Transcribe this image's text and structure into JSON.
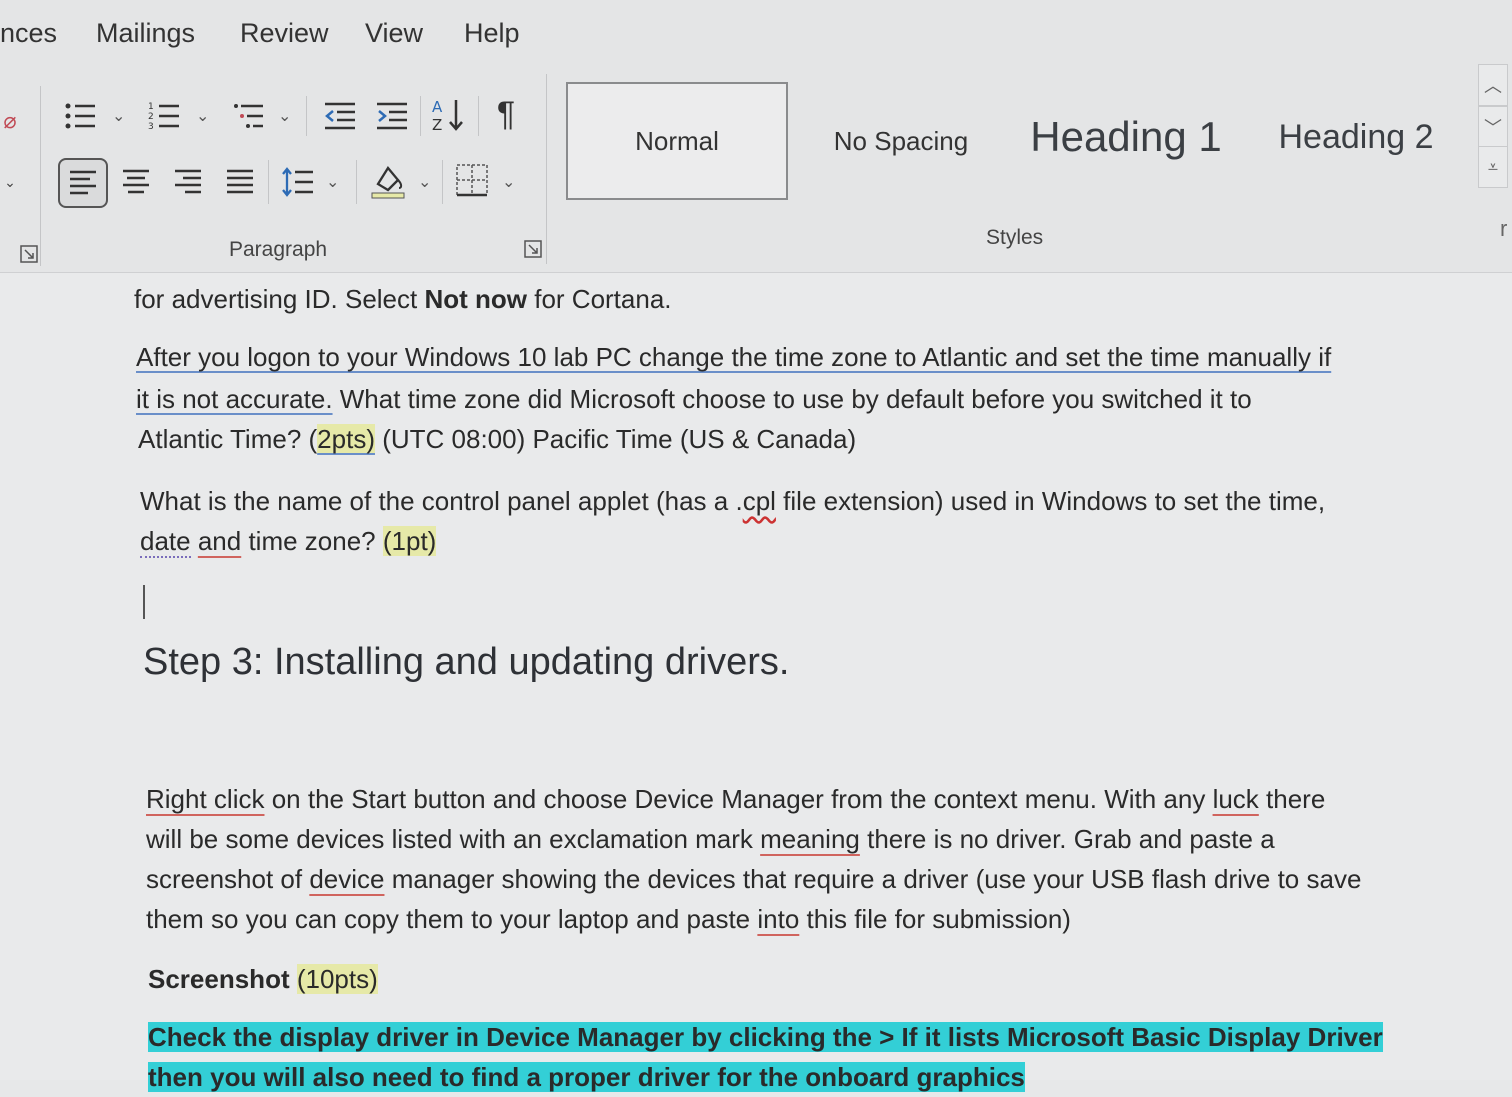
{
  "ribbon": {
    "tabs": [
      "nces",
      "Mailings",
      "Review",
      "View",
      "Help"
    ],
    "paragraph_label": "Paragraph",
    "styles_label": "Styles",
    "styles": [
      "Normal",
      "No Spacing",
      "Heading 1",
      "Heading 2"
    ],
    "icons": [
      "bullets-icon",
      "numbering-icon",
      "multilevel-list-icon",
      "decrease-indent-icon",
      "increase-indent-icon",
      "sort-icon",
      "show-formatting-icon",
      "align-left-icon",
      "align-center-icon",
      "align-right-icon",
      "justify-icon",
      "line-spacing-icon",
      "shading-icon",
      "borders-icon"
    ]
  },
  "document": {
    "line1_a": "for advertising ID. Select ",
    "line1_bold": "Not now",
    "line1_b": " for Cortana.",
    "q1_line1": "After you logon to your Windows 10 lab PC change the time zone to Atlantic and set the time manually if",
    "q1_line2_ul": "it is not accurate.",
    "q1_line2_rest": " What time zone did Microsoft choose to use by default before you switched it to",
    "q1_line3_a": "Atlantic Time? (",
    "q1_line3_pts": "2pts)",
    "q1_line3_answer": " (UTC 08:00) Pacific Time (US & Canada)",
    "q2_line1_a": "What is the name of the control panel applet (has a .",
    "q2_line1_cpl": "cpl",
    "q2_line1_b": " file extension) used in Windows to set the time,",
    "q2_line2_date": "date",
    "q2_line2_and": "and",
    "q2_line2_rest": " time zone?  ",
    "q2_line2_pts": "(1pt)",
    "heading": "Step 3: Installing and updating drivers.",
    "p3_line1_a": "Right click",
    "p3_line1_b": " on the Start button and choose Device Manager from the context menu. With any ",
    "p3_line1_luck": "luck",
    "p3_line1_c": " there",
    "p3_line2_a": "will be some devices listed with an exclamation mark ",
    "p3_line2_meaning": "meaning",
    "p3_line2_b": " there is no driver. Grab and paste a",
    "p3_line3_a": "screenshot of ",
    "p3_line3_device": "device",
    "p3_line3_b": " manager showing the devices that require a driver (use your USB flash drive to save",
    "p3_line4_a": "them so you can copy them to your laptop and paste ",
    "p3_line4_into": "into",
    "p3_line4_b": " this file for submission)",
    "screenshot_label": "Screenshot",
    "screenshot_pts": "(10pts)",
    "cyan_line1": "Check the display driver in Device Manager by clicking the > If it lists Microsoft Basic Display Driver",
    "cyan_line2": "then you will also need to find a proper driver for the onboard graphics"
  },
  "colors": {
    "highlight_yellow": "#e6e9a8",
    "highlight_cyan": "#33cfd6",
    "spell_red": "#d0645e"
  }
}
